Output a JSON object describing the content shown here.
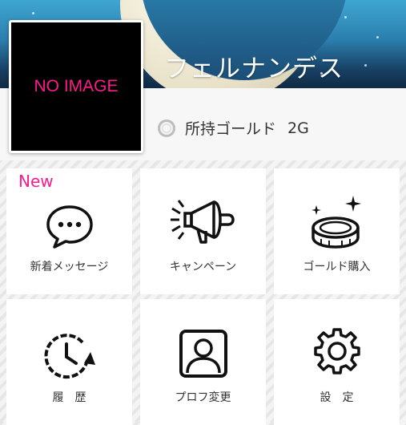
{
  "header": {
    "user_name": "フェルナンデス"
  },
  "avatar": {
    "placeholder_text": "NO IMAGE"
  },
  "gold": {
    "label": "所持ゴールド",
    "value": "2G"
  },
  "menu": {
    "new_badge": "New",
    "items": [
      {
        "label": "新着メッセージ",
        "icon": "chat-bubble-icon"
      },
      {
        "label": "キャンペーン",
        "icon": "megaphone-icon"
      },
      {
        "label": "ゴールド購入",
        "icon": "coin-stack-icon"
      },
      {
        "label": "履　歴",
        "icon": "history-clock-icon"
      },
      {
        "label": "プロフ変更",
        "icon": "profile-icon"
      },
      {
        "label": "設　定",
        "icon": "gear-icon"
      }
    ]
  },
  "colors": {
    "accent": "#ff1a8c",
    "banner_dark": "#173f62",
    "banner_light": "#3fa6d2"
  }
}
